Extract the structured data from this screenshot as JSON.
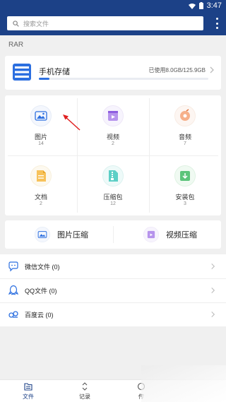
{
  "status_bar": {
    "time": "3:47"
  },
  "search": {
    "placeholder": "搜索文件"
  },
  "section": {
    "label": "RAR"
  },
  "storage": {
    "title": "手机存储",
    "usage": "已使用8.0GB/125.9GB",
    "used_fraction": 0.064
  },
  "categories": [
    {
      "label": "图片",
      "count": "14",
      "icon": "image-icon"
    },
    {
      "label": "视频",
      "count": "2",
      "icon": "video-icon"
    },
    {
      "label": "音频",
      "count": "7",
      "icon": "audio-icon"
    },
    {
      "label": "文档",
      "count": "2",
      "icon": "document-icon"
    },
    {
      "label": "压缩包",
      "count": "12",
      "icon": "archive-icon"
    },
    {
      "label": "安装包",
      "count": "3",
      "icon": "package-icon"
    }
  ],
  "compress": {
    "image_label": "图片压缩",
    "video_label": "视频压缩"
  },
  "sources": [
    {
      "label": "微信文件 (0)",
      "icon": "wechat-icon"
    },
    {
      "label": "QQ文件 (0)",
      "icon": "qq-icon"
    },
    {
      "label": "百度云 (0)",
      "icon": "baidu-cloud-icon"
    }
  ],
  "tabs": [
    {
      "label": "文件"
    },
    {
      "label": "记录"
    },
    {
      "label": "传"
    }
  ],
  "colors": {
    "primary": "#1c4187",
    "accent": "#2c6fe0",
    "active_tab": "#1c4187"
  }
}
